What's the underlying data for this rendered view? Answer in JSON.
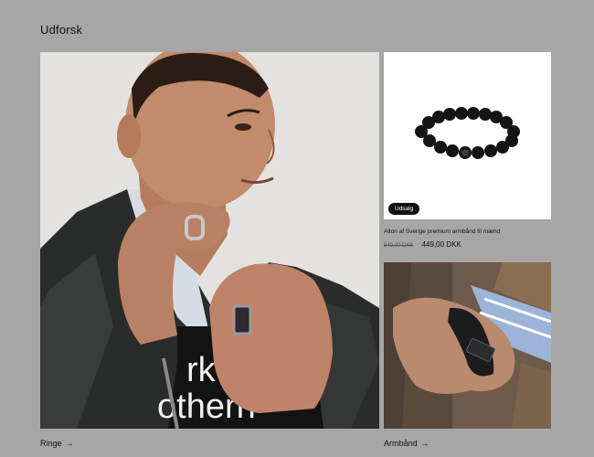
{
  "section": {
    "title": "Udforsk"
  },
  "hero": {
    "shirt_text_line1": "rk",
    "shirt_text_line2": "otherh"
  },
  "product": {
    "badge": "Udsalg",
    "title": "Alton af Sverige premium armbånd til mænd",
    "old_price": "549,00 DKK",
    "price": "449,00 DKK"
  },
  "collections": [
    {
      "label": "Ringe",
      "arrow": "→"
    },
    {
      "label": "Armbånd",
      "arrow": "→"
    }
  ]
}
